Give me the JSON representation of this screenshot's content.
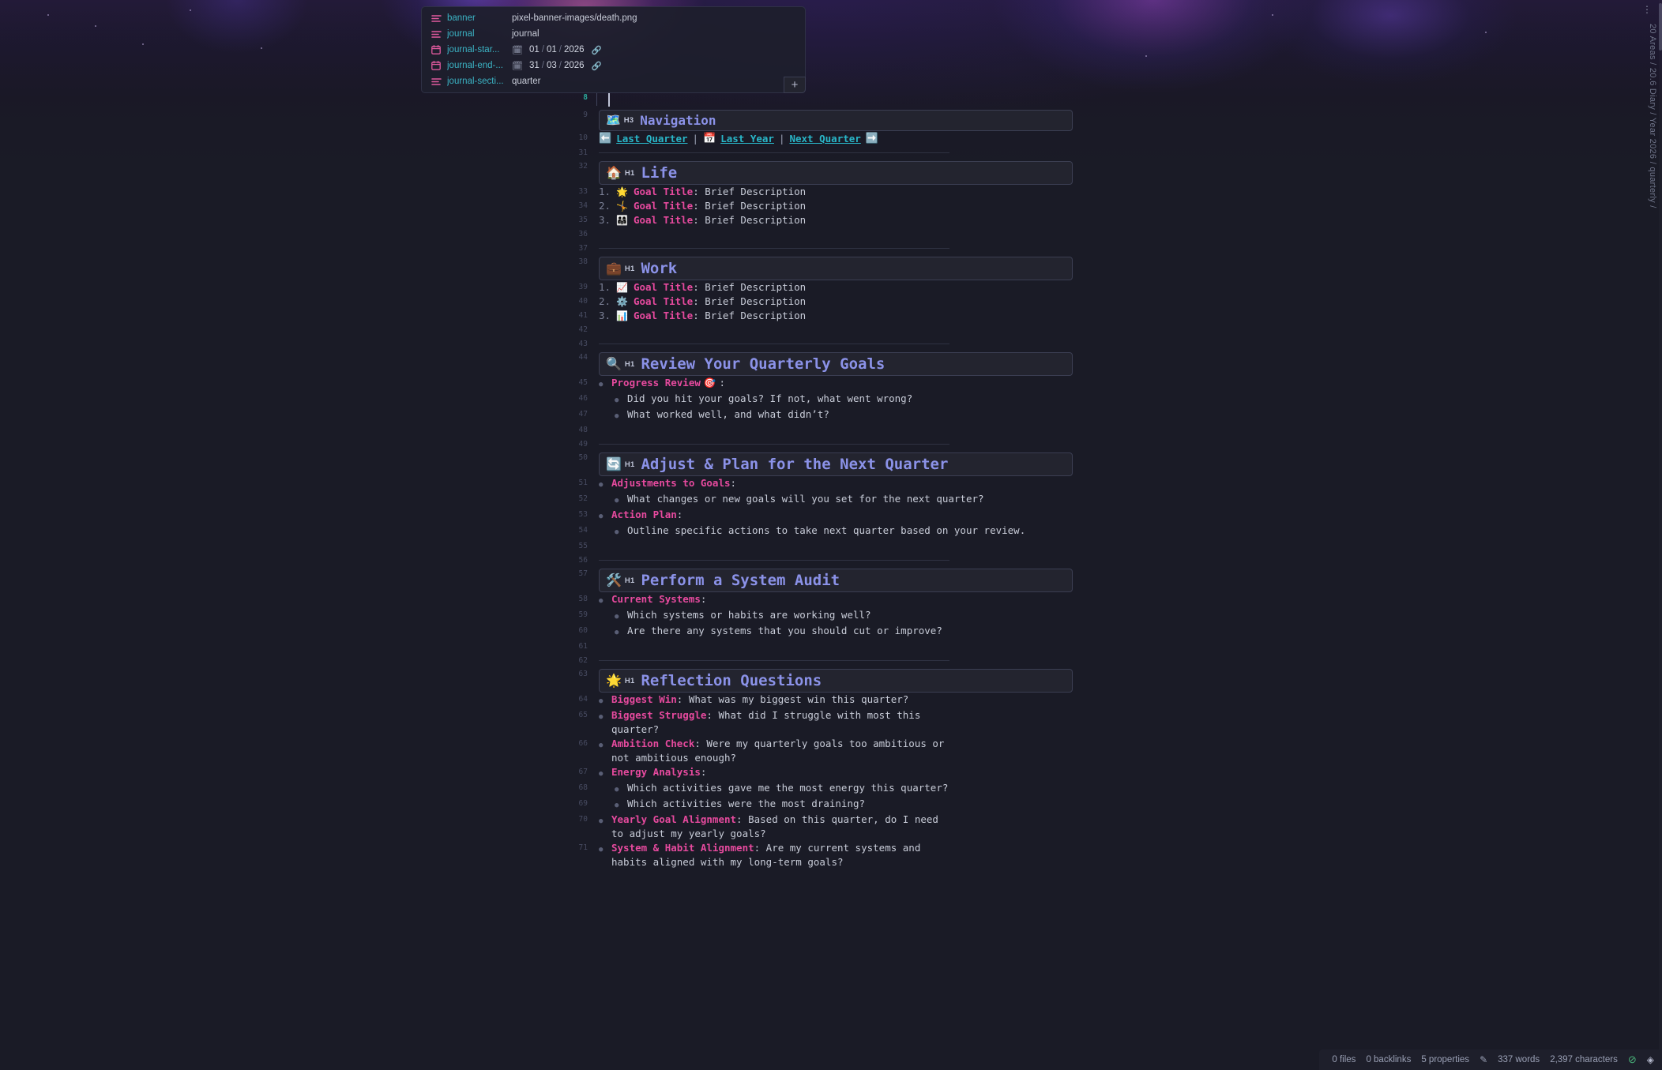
{
  "properties": {
    "rows": [
      {
        "icon": "text-lines-icon",
        "key": "banner",
        "value": "pixel-banner-images/death.png",
        "type": "text"
      },
      {
        "icon": "text-lines-icon",
        "key": "journal",
        "value": "journal",
        "type": "text"
      },
      {
        "icon": "calendar-icon",
        "key": "journal-star...",
        "value": "01/01/2026",
        "day": "01",
        "month": "01",
        "year": "2026",
        "type": "date"
      },
      {
        "icon": "calendar-icon",
        "key": "journal-end-...",
        "value": "31/03/2026",
        "day": "31",
        "month": "03",
        "year": "2026",
        "type": "date"
      },
      {
        "icon": "text-lines-icon",
        "key": "journal-secti...",
        "value": "quarter",
        "type": "text"
      }
    ],
    "add_button_label": "+"
  },
  "editor": {
    "caret_line_number": "8",
    "lines": {
      "nav_heading": "9",
      "nav_links": "10",
      "blank_31": "31",
      "life_heading": "32",
      "life_1": "33",
      "life_2": "34",
      "life_3": "35",
      "blank_36": "36",
      "blank_37": "37",
      "work_heading": "38",
      "work_1": "39",
      "work_2": "40",
      "work_3": "41",
      "blank_42": "42",
      "blank_43": "43",
      "review_heading": "44",
      "review_1": "45",
      "review_2": "46",
      "review_3": "47",
      "blank_48": "48",
      "blank_49": "49",
      "adjust_heading": "50",
      "adjust_1": "51",
      "adjust_2": "52",
      "adjust_3": "53",
      "adjust_4": "54",
      "blank_55": "55",
      "blank_56": "56",
      "audit_heading": "57",
      "audit_1": "58",
      "audit_2": "59",
      "audit_3": "60",
      "blank_61": "61",
      "blank_62": "62",
      "reflect_heading": "63",
      "reflect_1": "64",
      "reflect_2": "65",
      "reflect_3": "66",
      "reflect_4": "67",
      "reflect_5": "68",
      "reflect_6": "69",
      "reflect_7": "70",
      "reflect_8": "71"
    },
    "navigation": {
      "emoji": "🗺️",
      "badge": "H3",
      "title": "Navigation",
      "back_arrow": "⬅️",
      "last_quarter": "Last Quarter",
      "separator_1": "|",
      "calendar_emoji": "📅",
      "last_year": "Last Year",
      "separator_2": "|",
      "next_quarter": "Next Quarter",
      "forward_arrow": "➡️"
    },
    "life": {
      "emoji": "🏠",
      "badge": "H1",
      "title": "Life",
      "items": [
        {
          "num": "1.",
          "emoji": "🌟",
          "label": "Goal Title",
          "text": ": Brief Description"
        },
        {
          "num": "2.",
          "emoji": "🤸",
          "label": "Goal Title",
          "text": ": Brief Description"
        },
        {
          "num": "3.",
          "emoji": "👨‍👩‍👧",
          "label": "Goal Title",
          "text": ": Brief Description"
        }
      ]
    },
    "work": {
      "emoji": "💼",
      "badge": "H1",
      "title": "Work",
      "items": [
        {
          "num": "1.",
          "emoji": "📈",
          "label": "Goal Title",
          "text": ": Brief Description"
        },
        {
          "num": "2.",
          "emoji": "⚙️",
          "label": "Goal Title",
          "text": ": Brief Description"
        },
        {
          "num": "3.",
          "emoji": "📊",
          "label": "Goal Title",
          "text": ": Brief Description"
        }
      ]
    },
    "review": {
      "emoji": "🔍",
      "badge": "H1",
      "title": "Review Your Quarterly Goals",
      "label_1": "Progress Review",
      "label_1_emoji": "🎯",
      "label_1_suffix": ":",
      "sub_1": "Did you hit your goals? If not, what went wrong?",
      "sub_2": "What worked well, and what didn’t?"
    },
    "adjust": {
      "emoji": "🔄",
      "badge": "H1",
      "title": "Adjust & Plan for the Next Quarter",
      "label_1": "Adjustments to Goals",
      "label_1_suffix": ":",
      "sub_1": "What changes or new goals will you set for the next quarter?",
      "label_2": "Action Plan",
      "label_2_suffix": ":",
      "sub_2": "Outline specific actions to take next quarter based on your review."
    },
    "audit": {
      "emoji": "🛠️",
      "badge": "H1",
      "title": "Perform a System Audit",
      "label_1": "Current Systems",
      "label_1_suffix": ":",
      "sub_1": "Which systems or habits are working well?",
      "sub_2": "Are there any systems that you should cut or improve?"
    },
    "reflect": {
      "emoji": "🌟",
      "badge": "H1",
      "title": "Reflection Questions",
      "items": [
        {
          "label": "Biggest Win",
          "text": ": What was my biggest win this quarter?"
        },
        {
          "label": "Biggest Struggle",
          "text": ": What did I struggle with most this quarter?"
        },
        {
          "label": "Ambition Check",
          "text": ": Were my quarterly goals too ambitious or not ambitious enough?"
        },
        {
          "label": "Energy Analysis",
          "text": ":"
        }
      ],
      "energy_sub_1": "Which activities gave me the most energy this quarter?",
      "energy_sub_2": "Which activities were the most draining?",
      "items_tail": [
        {
          "label": "Yearly Goal Alignment",
          "text": ": Based on this quarter, do I need to adjust my yearly goals?"
        },
        {
          "label": "System & Habit Alignment",
          "text": ": Are my current systems and habits aligned with my long-term goals?"
        }
      ]
    }
  },
  "breadcrumb": {
    "text": "20 Areas / 20.6 Diary / Year 2026 / quarterly /",
    "menu_dots": "⋮"
  },
  "statusbar": {
    "files": "0 files",
    "backlinks": "0 backlinks",
    "properties": "5 properties",
    "pencil_icon": "✎",
    "words": "337 words",
    "characters": "2,397 characters",
    "sync_icon": "⊘",
    "diamond_icon": "◈"
  },
  "colors": {
    "background": "#1a1b26",
    "panel": "#23242f",
    "key_accent": "#3bb3c4",
    "heading_accent": "#8b92e8",
    "label_accent": "#e64a9e",
    "link_accent": "#29b6c8",
    "gutter_active": "#2ba89a"
  }
}
